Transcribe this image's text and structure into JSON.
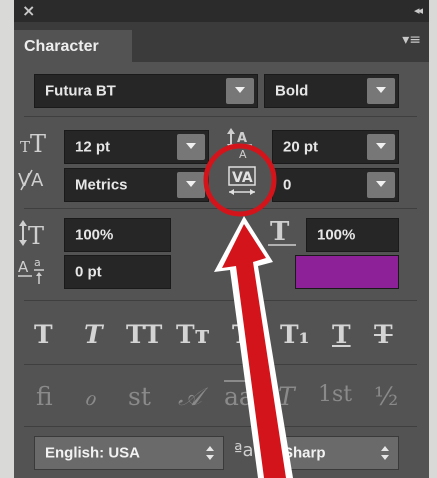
{
  "window": {
    "close_icon": "×",
    "collapse_icon": "◂◂",
    "tab_label": "Character",
    "menu_icon": "▾≡"
  },
  "font": {
    "family": "Futura BT",
    "style": "Bold"
  },
  "size": {
    "font_size": "12 pt",
    "leading": "20 pt"
  },
  "spacing": {
    "kerning": "Metrics",
    "tracking": "0"
  },
  "scale": {
    "vertical": "100%",
    "horizontal": "100%",
    "baseline_shift": "0 pt"
  },
  "color": {
    "text_color": "#8c2198",
    "annotation": "#d4141b"
  },
  "style_buttons": [
    "T",
    "T",
    "TT",
    "Tт",
    "T¹",
    "T₁",
    "T",
    "T"
  ],
  "opentype_buttons": [
    "ﬁ",
    "ℴ",
    "st",
    "𝒜",
    "aa",
    "T",
    "1st",
    "½"
  ],
  "language": "English: USA",
  "antialias_icon": "ªa",
  "antialias": "Sharp"
}
